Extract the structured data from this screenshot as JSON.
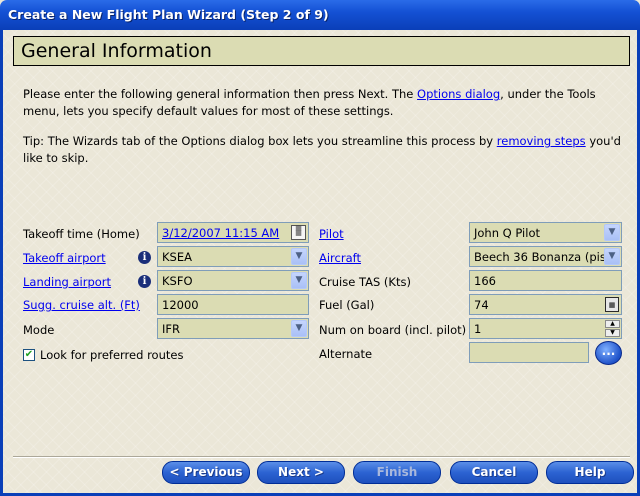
{
  "window": {
    "title": "Create a New Flight Plan Wizard  (Step 2 of 9)"
  },
  "header": {
    "title": "General Information"
  },
  "intro": {
    "text1": "Please enter the following general information then press Next.  The ",
    "link": "Options dialog",
    "text2": ", under the Tools menu, lets you specify default values for most of these settings."
  },
  "tip": {
    "text1": "Tip:  The Wizards tab of the Options dialog box lets you streamline this process by ",
    "link": "removing steps",
    "text2": " you'd like to skip."
  },
  "left": {
    "takeoff_time": {
      "label": "Takeoff time (Home)",
      "value": "3/12/2007 11:15 AM"
    },
    "takeoff_airport": {
      "label": "Takeoff airport",
      "value": "KSEA"
    },
    "landing_airport": {
      "label": "Landing airport",
      "value": "KSFO"
    },
    "cruise_alt": {
      "label": "Sugg. cruise alt. (Ft)",
      "value": "12000"
    },
    "mode": {
      "label": "Mode",
      "value": "IFR"
    },
    "preferred_routes": {
      "label": "Look for preferred routes",
      "checked": true
    }
  },
  "right": {
    "pilot": {
      "label": "Pilot",
      "value": "John Q Pilot"
    },
    "aircraft": {
      "label": "Aircraft",
      "value": "Beech 36 Bonanza (pis"
    },
    "cruise_tas": {
      "label": "Cruise TAS (Kts)",
      "value": "166"
    },
    "fuel": {
      "label": "Fuel (Gal)",
      "value": "74"
    },
    "num_on_board": {
      "label": "Num on board (incl. pilot)",
      "value": "1"
    },
    "alternate": {
      "label": "Alternate",
      "value": ""
    }
  },
  "buttons": {
    "previous": "< Previous",
    "next": "Next >",
    "finish": "Finish",
    "cancel": "Cancel",
    "help": "Help"
  },
  "icons": {
    "dropdown": "chevron-down-icon",
    "info": "info-icon",
    "calendar": "calendar-icon",
    "calculator": "calculator-icon"
  }
}
